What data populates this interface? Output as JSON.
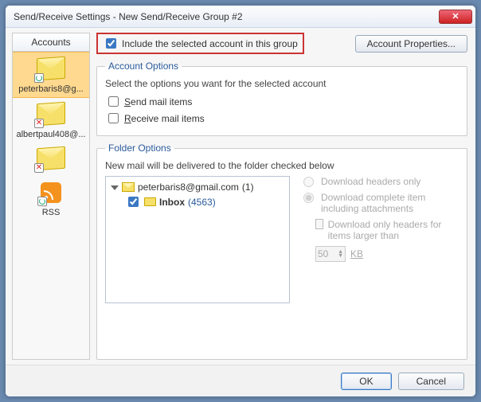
{
  "window": {
    "title": "Send/Receive Settings - New Send/Receive Group #2"
  },
  "sidebar": {
    "header": "Accounts",
    "accounts": [
      {
        "label": "peterbaris8@g..."
      },
      {
        "label": "albertpaul408@..."
      },
      {
        "label": ""
      }
    ],
    "rss_label": "RSS"
  },
  "include": {
    "label": "Include the selected account in this group",
    "checked": true
  },
  "account_properties_label": "Account Properties...",
  "account_options": {
    "legend": "Account Options",
    "prompt": "Select the options you want for the selected account",
    "send_label_pre": "S",
    "send_label_post": "end mail items",
    "receive_label_pre": "R",
    "receive_label_post": "eceive mail items"
  },
  "folder_options": {
    "legend": "Folder Options",
    "prompt": "New mail will be delivered to the folder checked below",
    "tree": {
      "root_label": "peterbaris8@gmail.com",
      "root_count": "(1)",
      "inbox_label": "Inbox",
      "inbox_count": "(4563)"
    },
    "download_headers": "Download headers only",
    "download_full": "Download complete item including attachments",
    "download_threshold": "Download only headers for items larger than",
    "spin_value": "50",
    "spin_unit": "KB"
  },
  "buttons": {
    "ok": "OK",
    "cancel": "Cancel"
  }
}
